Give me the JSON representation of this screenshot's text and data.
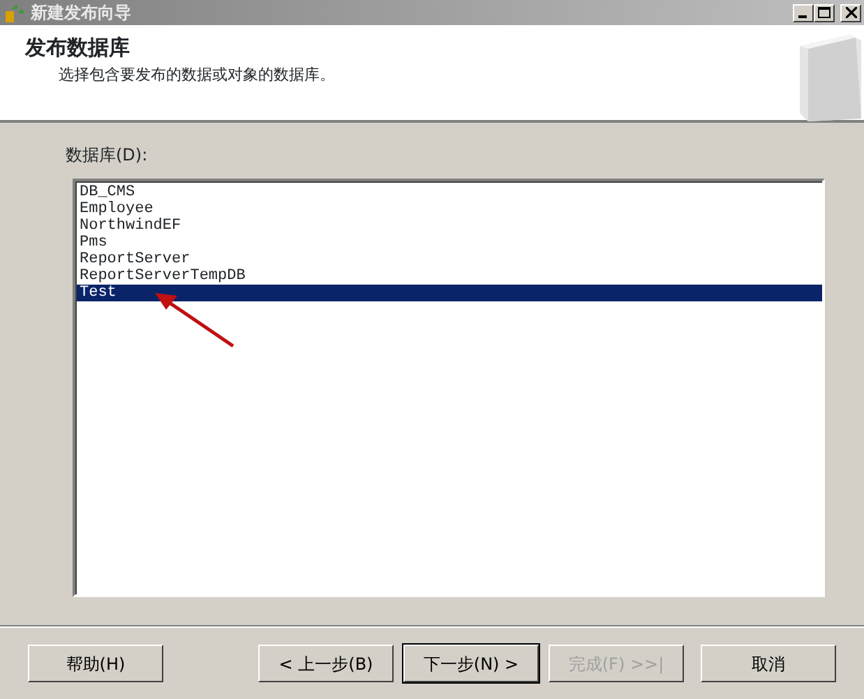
{
  "window": {
    "title": "新建发布向导"
  },
  "header": {
    "title": "发布数据库",
    "subtitle": "选择包含要发布的数据或对象的数据库。"
  },
  "list_label": "数据库(D):",
  "databases": [
    {
      "name": "DB_CMS",
      "selected": false
    },
    {
      "name": "Employee",
      "selected": false
    },
    {
      "name": "NorthwindEF",
      "selected": false
    },
    {
      "name": "Pms",
      "selected": false
    },
    {
      "name": "ReportServer",
      "selected": false
    },
    {
      "name": "ReportServerTempDB",
      "selected": false
    },
    {
      "name": "Test",
      "selected": true
    }
  ],
  "buttons": [
    {
      "label": "帮助(H)",
      "disabled": false,
      "default": false
    },
    {
      "label": "< 上一步(B)",
      "disabled": false,
      "default": false
    },
    {
      "label": "下一步(N) >",
      "disabled": false,
      "default": true
    },
    {
      "label": "完成(F) >>|",
      "disabled": true,
      "default": false
    },
    {
      "label": "取消",
      "disabled": false,
      "default": false
    }
  ]
}
